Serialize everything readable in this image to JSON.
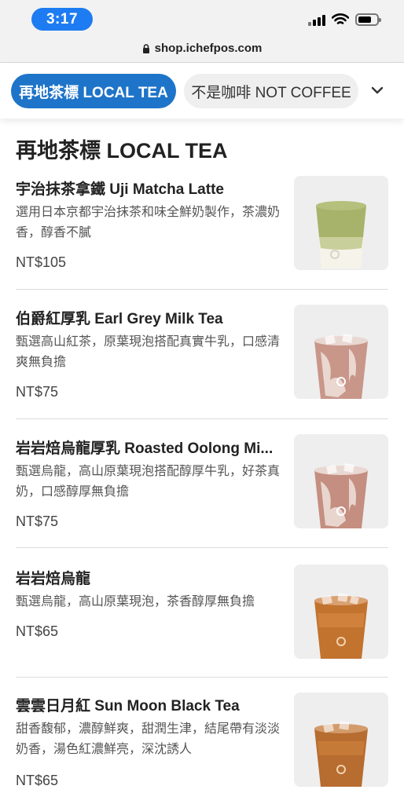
{
  "status_bar": {
    "time": "3:17"
  },
  "browser": {
    "url": "shop.ichefpos.com"
  },
  "category_tabs": [
    {
      "label": "再地茶標 LOCAL TEA",
      "active": true
    },
    {
      "label": "不是咖啡 NOT COFFEE",
      "active": false
    }
  ],
  "section": {
    "title": "再地茶標 LOCAL TEA"
  },
  "items": [
    {
      "name": "宇治抹茶拿鐵 Uji Matcha Latte",
      "description": "選用日本京都宇治抹茶和味全鮮奶製作，茶濃奶香，醇香不膩",
      "price": "NT$105",
      "photo": "matcha-latte"
    },
    {
      "name": "伯爵紅厚乳 Earl Grey Milk Tea",
      "description": "甄選高山紅茶，原葉現泡搭配真實牛乳，口感清爽無負擔",
      "price": "NT$75",
      "photo": "milk-tea"
    },
    {
      "name": "岩岩焙烏龍厚乳 Roasted Oolong Mi...",
      "description": "甄選烏龍，高山原葉現泡搭配醇厚牛乳，好茶真奶，口感醇厚無負擔",
      "price": "NT$75",
      "photo": "milk-tea"
    },
    {
      "name": "岩岩焙烏龍",
      "description": "甄選烏龍，高山原葉現泡，茶香醇厚無負擔",
      "price": "NT$65",
      "photo": "black-tea"
    },
    {
      "name": "雲雲日月紅 Sun Moon Black Tea",
      "description": "甜香馥郁，濃醇鮮爽，甜潤生津，結尾帶有淡淡奶香，湯色紅濃鮮亮，深沈誘人",
      "price": "NT$65",
      "photo": "black-tea"
    }
  ],
  "colors": {
    "accent": "#1e74c8",
    "time_pill": "#1e7cf2",
    "matcha": "#a7b36a",
    "milk_tea": "#c9968a",
    "black_tea": "#c2732e"
  }
}
